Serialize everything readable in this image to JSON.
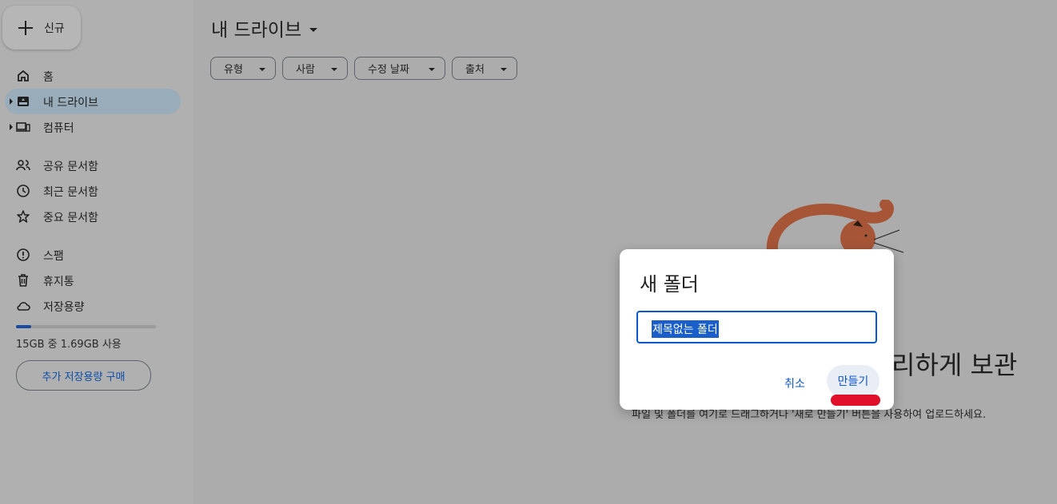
{
  "sidebar": {
    "new_label": "신규",
    "items": [
      {
        "label": "홈",
        "icon": "home-icon"
      },
      {
        "label": "내 드라이브",
        "icon": "drive-icon"
      },
      {
        "label": "컴퓨터",
        "icon": "computer-icon"
      },
      {
        "label": "공유 문서함",
        "icon": "people-icon"
      },
      {
        "label": "최근 문서함",
        "icon": "clock-icon"
      },
      {
        "label": "중요 문서함",
        "icon": "star-icon"
      },
      {
        "label": "스팸",
        "icon": "spam-icon"
      },
      {
        "label": "휴지통",
        "icon": "trash-icon"
      },
      {
        "label": "저장용량",
        "icon": "cloud-icon"
      }
    ],
    "storage_text": "15GB 중 1.69GB 사용",
    "storage_fraction": 0.11,
    "buy_storage_label": "추가 저장용량 구매"
  },
  "main": {
    "title": "내 드라이브",
    "filters": [
      "유형",
      "사람",
      "수정 날짜",
      "출처"
    ],
    "empty_title": "리하게 보관",
    "empty_subtitle": "파일 및 폴더를 여기로 드래그하거나 '새로 만들기' 버튼을 사용하여 업로드하세요."
  },
  "dialog": {
    "title": "새 폴더",
    "input_value": "제목없는 폴더",
    "cancel_label": "취소",
    "create_label": "만들기"
  },
  "colors": {
    "accent": "#0b57d0",
    "active_nav": "#98adb9",
    "annotation": "#e0102a"
  }
}
